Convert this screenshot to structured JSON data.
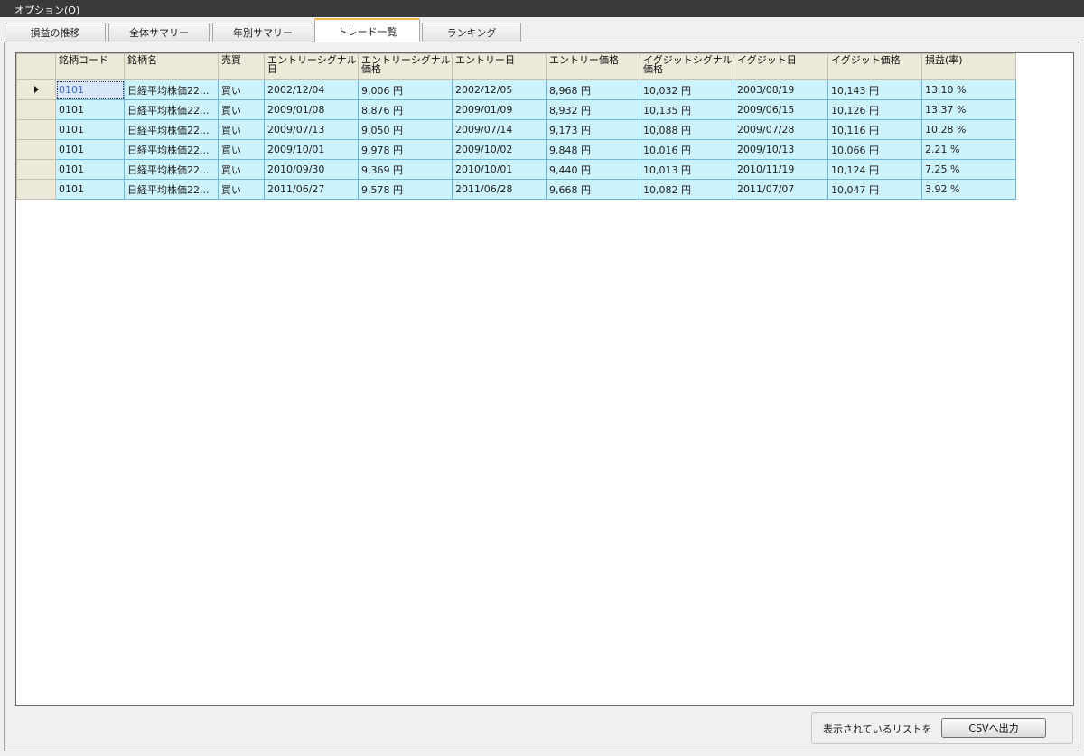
{
  "menu": {
    "options_label": "オプション(O)"
  },
  "tabs": [
    {
      "label": "損益の推移",
      "active": false
    },
    {
      "label": "全体サマリー",
      "active": false
    },
    {
      "label": "年別サマリー",
      "active": false
    },
    {
      "label": "トレード一覧",
      "active": true
    },
    {
      "label": "ランキング",
      "active": false
    }
  ],
  "grid": {
    "columns": [
      "銘柄コード",
      "銘柄名",
      "売買",
      "エントリーシグナル日",
      "エントリーシグナル価格",
      "エントリー日",
      "エントリー価格",
      "イグジットシグナル価格",
      "イグジット日",
      "イグジット価格",
      "損益(率)"
    ],
    "rows": [
      [
        "0101",
        "日経平均株価22...",
        "買い",
        "2002/12/04",
        "9,006 円",
        "2002/12/05",
        "8,968 円",
        "10,032 円",
        "2003/08/19",
        "10,143 円",
        "13.10 %"
      ],
      [
        "0101",
        "日経平均株価22...",
        "買い",
        "2009/01/08",
        "8,876 円",
        "2009/01/09",
        "8,932 円",
        "10,135 円",
        "2009/06/15",
        "10,126 円",
        "13.37 %"
      ],
      [
        "0101",
        "日経平均株価22...",
        "買い",
        "2009/07/13",
        "9,050 円",
        "2009/07/14",
        "9,173 円",
        "10,088 円",
        "2009/07/28",
        "10,116 円",
        "10.28 %"
      ],
      [
        "0101",
        "日経平均株価22...",
        "買い",
        "2009/10/01",
        "9,978 円",
        "2009/10/02",
        "9,848 円",
        "10,016 円",
        "2009/10/13",
        "10,066 円",
        "2.21 %"
      ],
      [
        "0101",
        "日経平均株価22...",
        "買い",
        "2010/09/30",
        "9,369 円",
        "2010/10/01",
        "9,440 円",
        "10,013 円",
        "2010/11/19",
        "10,124 円",
        "7.25 %"
      ],
      [
        "0101",
        "日経平均株価22...",
        "買い",
        "2011/06/27",
        "9,578 円",
        "2011/06/28",
        "9,668 円",
        "10,082 円",
        "2011/07/07",
        "10,047 円",
        "3.92 %"
      ]
    ]
  },
  "footer": {
    "label": "表示されているリストを",
    "csv_button": "CSVへ出力"
  },
  "colors": {
    "row_fill": "#ccf2fc",
    "row_border": "#6cb8e4",
    "header_fill": "#ece9d8",
    "active_tab_accent": "#f2b645",
    "menubar": "#3a3a3a"
  }
}
